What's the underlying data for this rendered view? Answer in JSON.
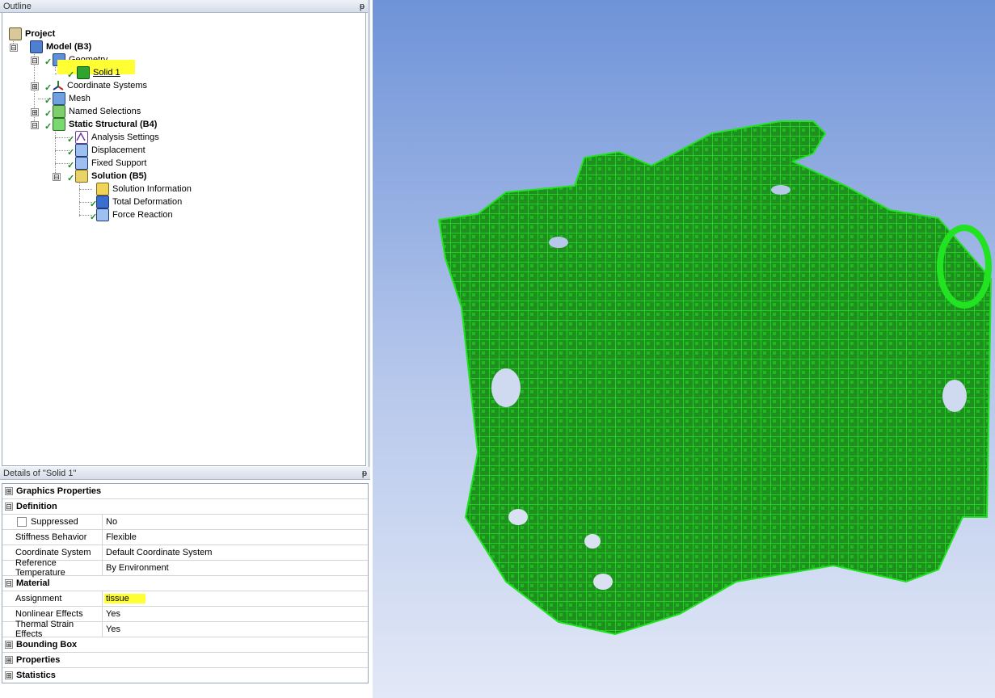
{
  "outline": {
    "title": "Outline",
    "pin": "ᵽ",
    "tree": [
      {
        "label": "Project",
        "bold": true
      },
      {
        "label": "Model (B3)",
        "bold": true
      },
      {
        "label": "Geometry"
      },
      {
        "label": "Solid 1",
        "highlight": true
      },
      {
        "label": "Coordinate Systems"
      },
      {
        "label": "Mesh"
      },
      {
        "label": "Named Selections"
      },
      {
        "label": "Static Structural (B4)",
        "bold": true
      },
      {
        "label": "Analysis Settings"
      },
      {
        "label": "Displacement"
      },
      {
        "label": "Fixed Support"
      },
      {
        "label": "Solution (B5)",
        "bold": true
      },
      {
        "label": "Solution Information"
      },
      {
        "label": "Total Deformation"
      },
      {
        "label": "Force Reaction"
      }
    ]
  },
  "details": {
    "title": "Details of \"Solid 1\"",
    "pin": "ᵽ",
    "groups": [
      {
        "label": "Graphics Properties",
        "expanded": false
      },
      {
        "label": "Definition",
        "expanded": true,
        "rows": [
          {
            "key": "Suppressed",
            "value": "No",
            "checkbox": true
          },
          {
            "key": "Stiffness Behavior",
            "value": "Flexible"
          },
          {
            "key": "Coordinate System",
            "value": "Default Coordinate System"
          },
          {
            "key": "Reference Temperature",
            "value": "By Environment"
          }
        ]
      },
      {
        "label": "Material",
        "expanded": true,
        "rows": [
          {
            "key": "Assignment",
            "value": "tissue",
            "highlight": true
          },
          {
            "key": "Nonlinear Effects",
            "value": "Yes"
          },
          {
            "key": "Thermal Strain Effects",
            "value": "Yes"
          }
        ]
      },
      {
        "label": "Bounding Box",
        "expanded": false
      },
      {
        "label": "Properties",
        "expanded": false
      },
      {
        "label": "Statistics",
        "expanded": false
      }
    ]
  },
  "colors": {
    "model_dark": "#1f8f1f",
    "model_light": "#22e322",
    "highlight": "#ffff33",
    "bg_top": "#6f93d8",
    "bg_bottom": "#e2e8f6"
  },
  "icons": {
    "expand": "⊞",
    "collapse": "⊟",
    "check": "✓"
  }
}
